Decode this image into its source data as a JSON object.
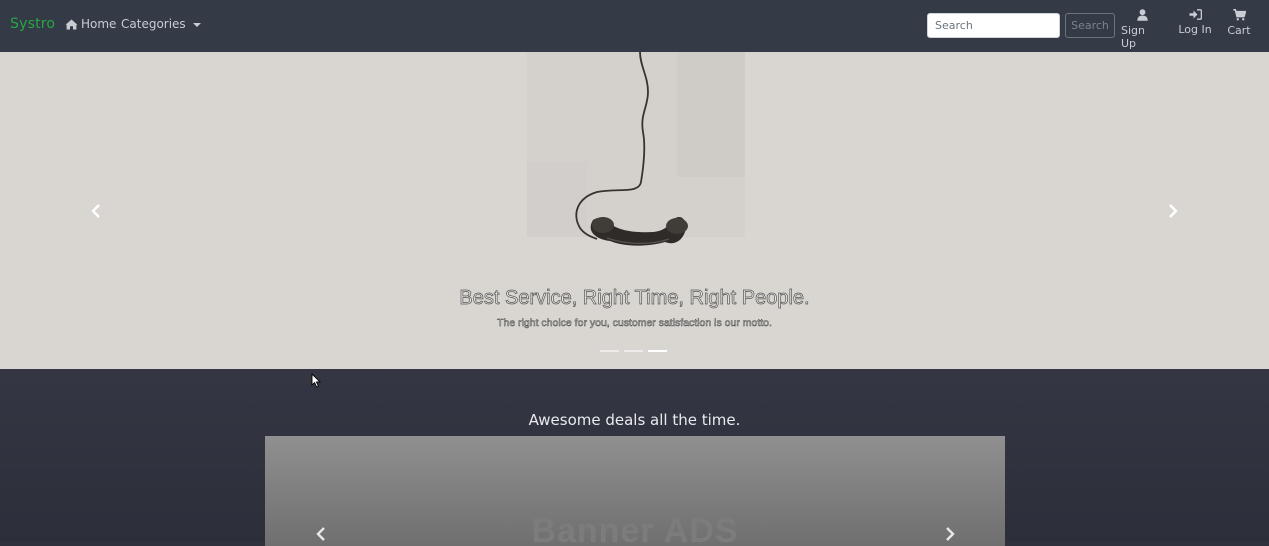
{
  "navbar": {
    "brand": "Systro",
    "home_label": "Home",
    "categories_label": "Categories",
    "search_placeholder": "Search",
    "search_button": "Search",
    "signup_label": "Sign Up",
    "login_label": "Log In",
    "cart_label": "Cart",
    "brand_color": "#28a745"
  },
  "hero": {
    "title": "Best Service, Right Time, Right People.",
    "caption": "The right choice for you, customer satisfaction is our motto.",
    "slide_count": 3,
    "active_slide": 3
  },
  "deals": {
    "heading": "Awesome deals all the time.",
    "banner_text": "Banner ADS"
  }
}
